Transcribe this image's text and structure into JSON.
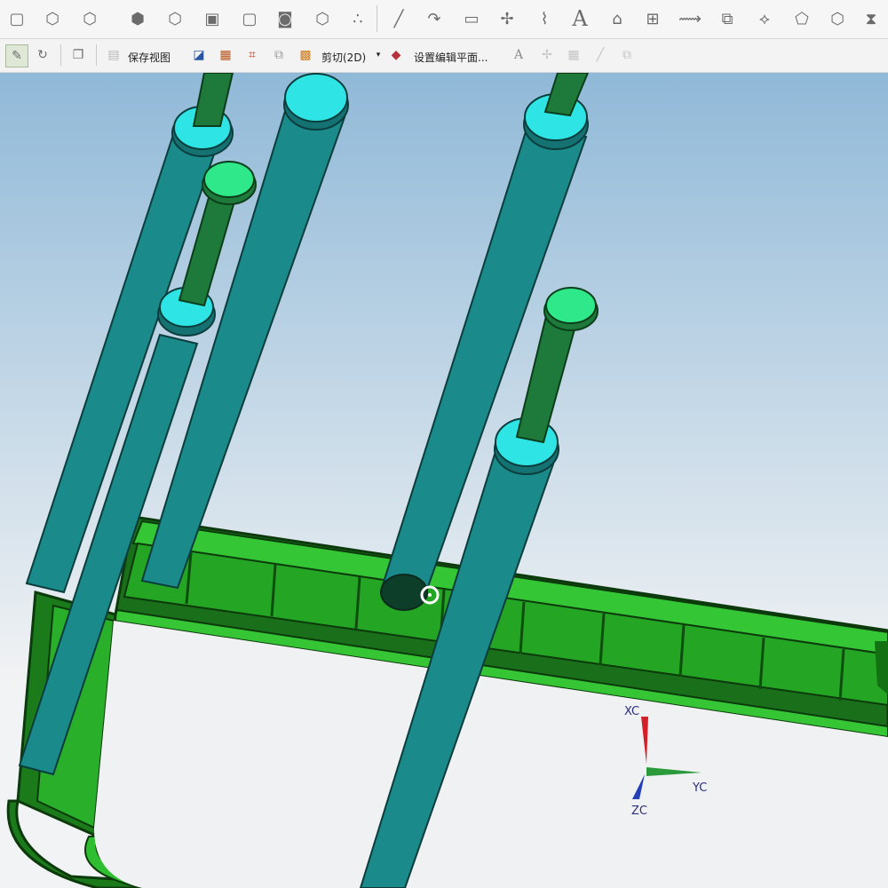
{
  "toolbar_top": {
    "icons": [
      "cube-view-icon",
      "top-view-icon",
      "front-view-icon",
      "right-view-icon",
      "iso-view-icon",
      "left-view-icon",
      "back-view-icon",
      "bottom-view-icon",
      "shaded-view-icon",
      "render-style-icon",
      "line-icon",
      "arc-icon",
      "rectangle-icon",
      "point-set-icon",
      "curve-icon",
      "text-icon",
      "lock-icon",
      "mirror-icon",
      "transform-icon",
      "bridge-icon",
      "offset-icon",
      "extend-icon"
    ],
    "text_icon_glyph": "A"
  },
  "toolbar_bottom": {
    "save_view_label": "保存视图",
    "region_label": "剪切(2D)",
    "set_plane_label": "设置编辑平面...",
    "text_icon_glyph": "A"
  },
  "viewport": {
    "colors": {
      "bg_top": "#90b9d8",
      "bg_bottom": "#f2f3f4",
      "tray_green": "#2fbe2f",
      "tray_dark": "#136613",
      "pin_teal": "#1b8a8a",
      "pin_cap": "#2fe4e4",
      "stem_green": "#1d7a3a",
      "stem_cap": "#2ee88a"
    }
  },
  "triad": {
    "xc_label": "XC",
    "yc_label": "YC",
    "zc_label": "ZC"
  }
}
